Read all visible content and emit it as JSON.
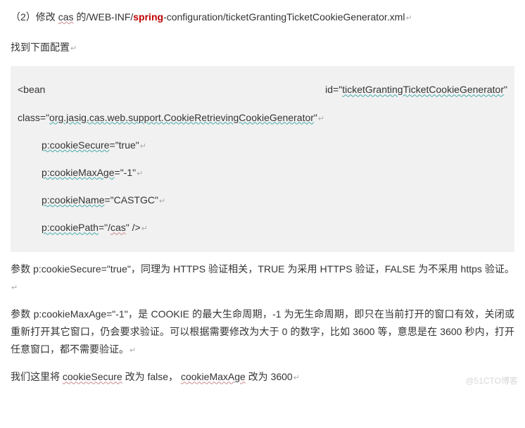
{
  "title": {
    "prefix": "（2）修改 ",
    "cas": "cas",
    "mid1": " 的/WEB-INF/",
    "spring": "spring",
    "suffix": "-configuration/ticketGrantingTicketCookieGenerator.xml",
    "ret": "↵"
  },
  "para1": {
    "text": "找到下面配置",
    "ret": "↵"
  },
  "code": {
    "bean": "<bean",
    "id_label": "id=\"",
    "id_value": "ticketGrantingTicketCookieGenerator",
    "id_close": "\"",
    "class_label": "class=\"",
    "class_value": "org.jasig.cas.web.support.CookieRetrievingCookieGenerator",
    "class_close": "\"",
    "p1a": "p:cookieSecure",
    "p1b": "=\"true\"",
    "p2a": "p:cookieMaxAge",
    "p2b": "=\"-1\"",
    "p3a": "p:cookieName",
    "p3b": "=\"CASTGC\"",
    "p4a": "p:cookiePath",
    "p4b": "=\"/",
    "p4c": "cas",
    "p4d": "\" />",
    "ret": "↵"
  },
  "para2": {
    "text": "参数 p:cookieSecure=\"true\"，同理为 HTTPS 验证相关，TRUE 为采用 HTTPS 验证，FALSE 为不采用 https 验证。",
    "ret": "↵"
  },
  "para3": {
    "text": "参数 p:cookieMaxAge=\"-1\"，是 COOKIE 的最大生命周期，-1 为无生命周期，即只在当前打开的窗口有效，关闭或重新打开其它窗口，仍会要求验证。可以根据需要修改为大于 0 的数字，比如 3600 等，意思是在 3600 秒内，打开任意窗口，都不需要验证。",
    "ret": "↵"
  },
  "para4": {
    "t1": "我们这里将 ",
    "w1": "cookieSecure",
    "t2": " 改为 false，   ",
    "w2": "cookieMaxAge",
    "t3": "  改为 3600",
    "ret": "↵"
  },
  "watermark": "@51CTO博客"
}
